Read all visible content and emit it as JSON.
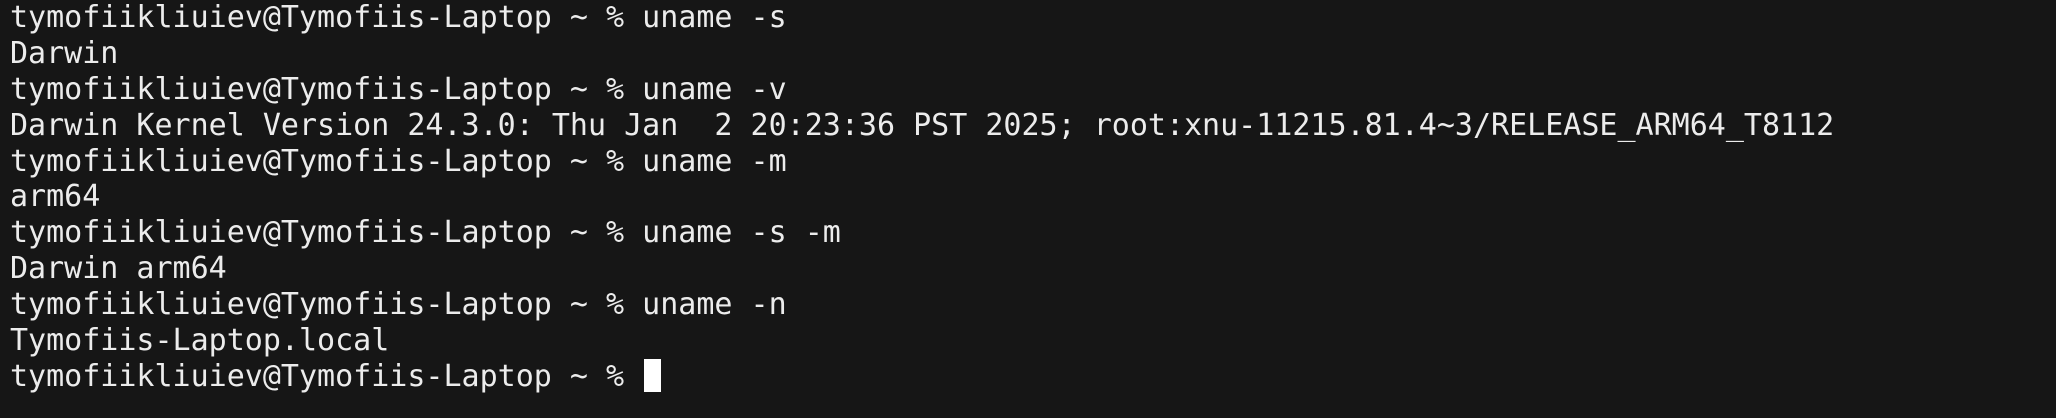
{
  "lines": [
    {
      "kind": "command",
      "prompt": "tymofiikliuiev@Tymofiis-Laptop ~ % ",
      "command": "uname -s"
    },
    {
      "kind": "output",
      "text": "Darwin"
    },
    {
      "kind": "command",
      "prompt": "tymofiikliuiev@Tymofiis-Laptop ~ % ",
      "command": "uname -v"
    },
    {
      "kind": "output",
      "text": "Darwin Kernel Version 24.3.0: Thu Jan  2 20:23:36 PST 2025; root:xnu-11215.81.4~3/RELEASE_ARM64_T8112"
    },
    {
      "kind": "command",
      "prompt": "tymofiikliuiev@Tymofiis-Laptop ~ % ",
      "command": "uname -m"
    },
    {
      "kind": "output",
      "text": "arm64"
    },
    {
      "kind": "command",
      "prompt": "tymofiikliuiev@Tymofiis-Laptop ~ % ",
      "command": "uname -s -m"
    },
    {
      "kind": "output",
      "text": "Darwin arm64"
    },
    {
      "kind": "command",
      "prompt": "tymofiikliuiev@Tymofiis-Laptop ~ % ",
      "command": "uname -n"
    },
    {
      "kind": "output",
      "text": "Tymofiis-Laptop.local"
    }
  ],
  "current_prompt": "tymofiikliuiev@Tymofiis-Laptop ~ % ",
  "colors": {
    "background": "#161616",
    "text": "#ececec",
    "cursor": "#ffffff"
  }
}
